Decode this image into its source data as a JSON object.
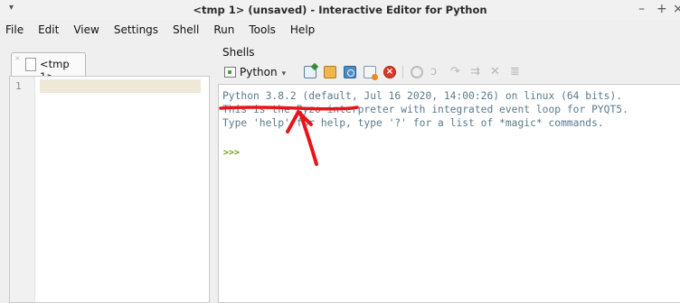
{
  "window": {
    "menu_glyph": "▾",
    "title": "<tmp 1> (unsaved) - Interactive Editor for Python",
    "minimize": "–",
    "maximize": "+",
    "close": "×"
  },
  "menubar": {
    "items": [
      "File",
      "Edit",
      "View",
      "Settings",
      "Shell",
      "Run",
      "Tools",
      "Help"
    ]
  },
  "editor": {
    "tab_close_glyph": "×",
    "tab_label": "<tmp 1>",
    "line_numbers": [
      "1"
    ],
    "current_line_color": "#eee8d8"
  },
  "shells": {
    "title": "Shells",
    "tab_label": "Python",
    "tab_chevron": "▾",
    "toolbar_icons": [
      "new-shell-icon",
      "edit-config-icon",
      "restart-icon",
      "interrupt-icon",
      "terminate-icon",
      "debug-continue-icon",
      "debug-step-over-icon",
      "debug-step-in-icon",
      "debug-step-out-icon",
      "debug-stop-icon",
      "stack-list-icon"
    ],
    "terminate_glyph": "×",
    "debug_glyphs": [
      "ↄ",
      "↷",
      "⇉",
      "✕",
      "≣"
    ],
    "output_lines": [
      "Python 3.8.2 (default, Jul 16 2020, 14:00:26) on linux (64 bits).",
      "This is the Pyzo interpreter with integrated event loop for PYQT5.",
      "Type 'help' for help, type '?' for a list of *magic* commands."
    ],
    "prompt": ">>>"
  },
  "colors": {
    "annotation_red": "#e8141b",
    "prompt_green": "#7a9a20",
    "output_text": "#5a7a8c"
  }
}
